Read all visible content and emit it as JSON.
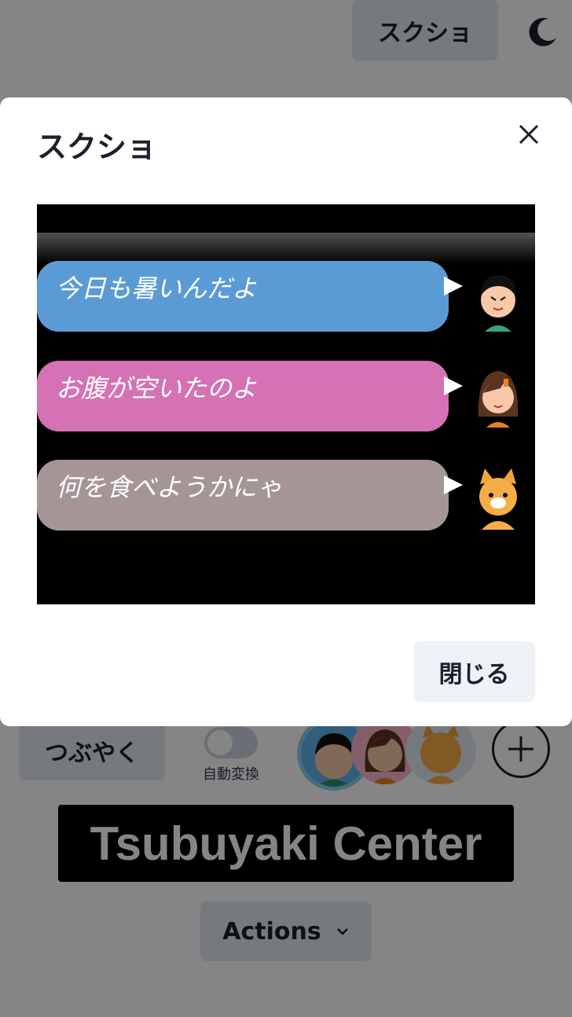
{
  "header": {
    "screenshot_button_label": "スクショ",
    "theme_icon": "moon-icon"
  },
  "composer": {
    "tsubuyaku_button_label": "つぶやく",
    "auto_convert_label": "自動変換",
    "auto_convert_on": false,
    "add_button_icon": "plus-icon"
  },
  "main": {
    "title": "Tsubuyaki Center",
    "actions_label": "Actions"
  },
  "modal": {
    "title": "スクショ",
    "close_icon": "close-icon",
    "close_button_label": "閉じる",
    "messages": [
      {
        "text": "今日も暑いんだよ",
        "color": "#5b9bd5",
        "speaker": "boy"
      },
      {
        "text": "お腹が空いたのよ",
        "color": "#d472b5",
        "speaker": "girl"
      },
      {
        "text": "何を食べようかにゃ",
        "color": "#a59597",
        "speaker": "cat"
      }
    ]
  },
  "colors": {
    "overlay": "rgba(0,0,0,0.48)",
    "button_bg": "#e2e8f0",
    "title_bg": "#000000"
  }
}
